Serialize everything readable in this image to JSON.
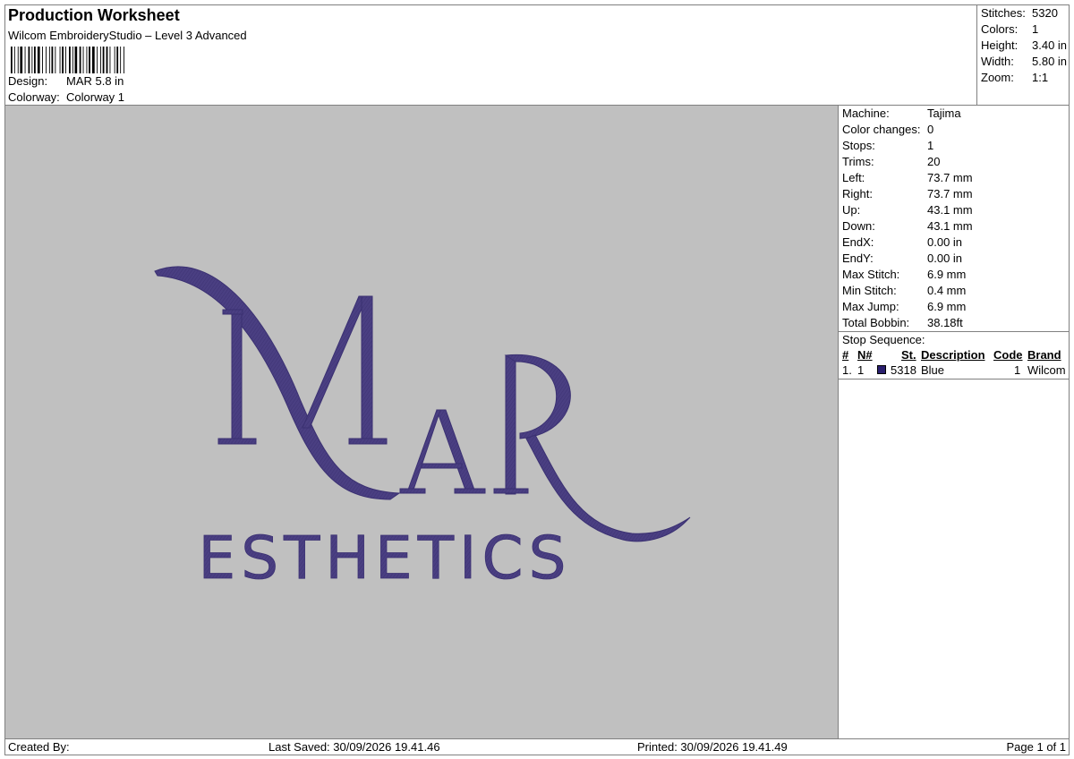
{
  "header": {
    "title": "Production Worksheet",
    "software": "Wilcom EmbroideryStudio – Level 3 Advanced",
    "design_label": "Design:",
    "design_value": "MAR 5.8 in",
    "colorway_label": "Colorway:",
    "colorway_value": "Colorway 1"
  },
  "stats": {
    "stitches_label": "Stitches:",
    "stitches": "5320",
    "colors_label": "Colors:",
    "colors": "1",
    "height_label": "Height:",
    "height": "3.40 in",
    "width_label": "Width:",
    "width": "5.80 in",
    "zoom_label": "Zoom:",
    "zoom": "1:1"
  },
  "machine_info": [
    {
      "label": "Machine:",
      "value": "Tajima"
    },
    {
      "label": "Color changes:",
      "value": "0"
    },
    {
      "label": "Stops:",
      "value": "1"
    },
    {
      "label": "Trims:",
      "value": "20"
    },
    {
      "label": "Left:",
      "value": "73.7 mm"
    },
    {
      "label": "Right:",
      "value": "73.7 mm"
    },
    {
      "label": "Up:",
      "value": "43.1 mm"
    },
    {
      "label": "Down:",
      "value": "43.1 mm"
    },
    {
      "label": "EndX:",
      "value": "0.00 in"
    },
    {
      "label": "EndY:",
      "value": "0.00 in"
    },
    {
      "label": "Max Stitch:",
      "value": "6.9 mm"
    },
    {
      "label": "Min Stitch:",
      "value": "0.4 mm"
    },
    {
      "label": "Max Jump:",
      "value": "6.9 mm"
    },
    {
      "label": "Total Bobbin:",
      "value": "38.18ft"
    }
  ],
  "stop_sequence": {
    "label": "Stop Sequence:",
    "headers": {
      "stop": "#",
      "needle": "N#",
      "st": "St.",
      "description": "Description",
      "code": "Code",
      "brand": "Brand"
    },
    "rows": [
      {
        "stop": "1.",
        "needle": "1",
        "st": "5318",
        "description": "Blue",
        "code": "1",
        "brand": "Wilcom",
        "color": "#2a1f6e"
      }
    ]
  },
  "design_preview": {
    "background": "#c0c0c0",
    "thread_color": "#4a3f82",
    "monogram_m": "M",
    "monogram_a": "A",
    "monogram_r": "R",
    "tagline": "ESTHETICS"
  },
  "footer": {
    "created_by": "Created By:",
    "last_saved": "Last Saved: 30/09/2026 19.41.46",
    "printed": "Printed: 30/09/2026 19.41.49",
    "page": "Page 1 of 1"
  }
}
